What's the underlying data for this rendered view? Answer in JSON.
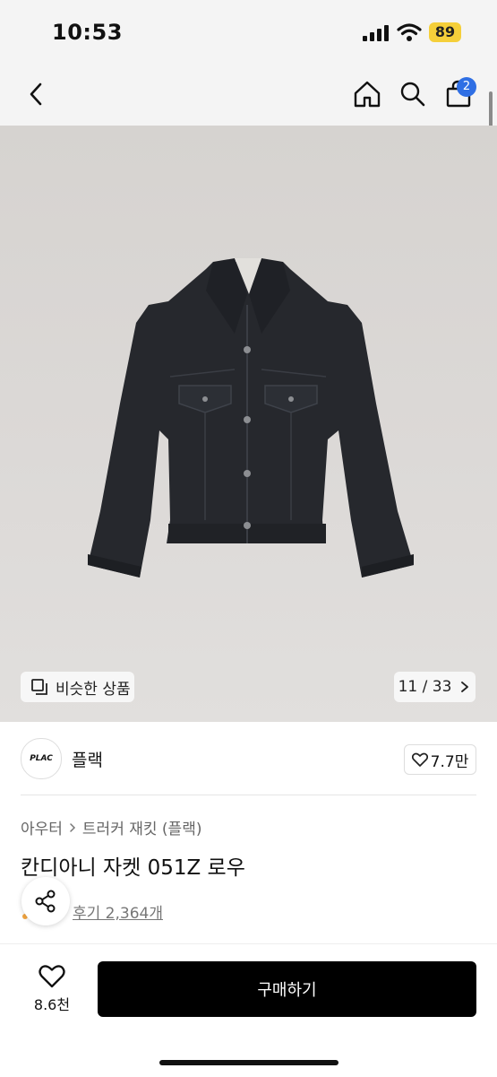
{
  "status": {
    "time": "10:53",
    "battery": "89"
  },
  "nav": {
    "cart_count": "2"
  },
  "gallery": {
    "similar_label": "비슷한 상품",
    "counter": "11 / 33"
  },
  "brand": {
    "logo_text": "PLAC",
    "name": "플랙",
    "likes": "7.7만"
  },
  "product": {
    "breadcrumb": [
      "아우터",
      "트러커 재킷 (플랙)"
    ],
    "title": "칸디아니 자켓 051Z 로우",
    "review_link": "후기 2,364개"
  },
  "bottom": {
    "fav_count": "8.6천",
    "buy_label": "구매하기"
  },
  "colors": {
    "accent_badge": "#2f6fe4",
    "battery": "#f5cf3a",
    "buy_button": "#000000"
  },
  "icons": [
    "back-icon",
    "home-icon",
    "search-icon",
    "cart-icon",
    "similar-icon",
    "chevron-right-icon",
    "heart-icon",
    "share-icon"
  ]
}
